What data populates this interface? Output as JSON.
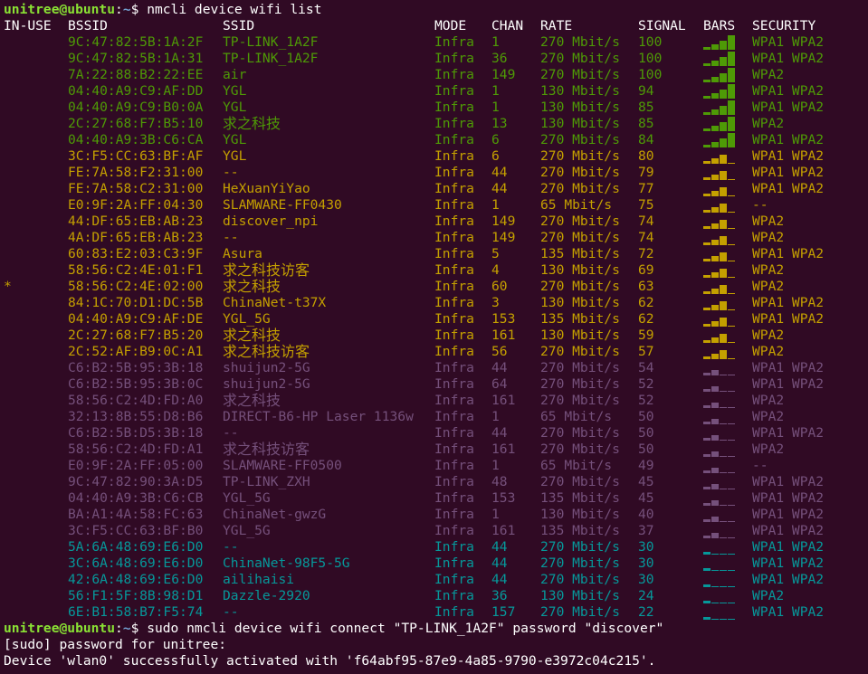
{
  "colors": {
    "background": "#300a24",
    "text": "#ffffff",
    "prompt_user": "#8ae234",
    "prompt_path": "#729fcf",
    "strong": "#4e9a06",
    "good": "#c4a000",
    "fair": "#75507b",
    "weak": "#06989a"
  },
  "prompt1": {
    "user": "unitree@ubuntu",
    "path": "~",
    "symbol": "$",
    "command": "nmcli device wifi list"
  },
  "headers": {
    "in_use": "IN-USE",
    "bssid": "BSSID",
    "ssid": "SSID",
    "mode": "MODE",
    "chan": "CHAN",
    "rate": "RATE",
    "signal": "SIGNAL",
    "bars": "BARS",
    "security": "SECURITY"
  },
  "rows": [
    {
      "in_use": "",
      "bssid": "9C:47:82:5B:1A:2F",
      "ssid": "TP-LINK_1A2F",
      "mode": "Infra",
      "chan": "1",
      "rate": "270 Mbit/s",
      "signal": "100",
      "bars": 4,
      "security": "WPA1 WPA2",
      "color": "strong"
    },
    {
      "in_use": "",
      "bssid": "9C:47:82:5B:1A:31",
      "ssid": "TP-LINK_1A2F",
      "mode": "Infra",
      "chan": "36",
      "rate": "270 Mbit/s",
      "signal": "100",
      "bars": 4,
      "security": "WPA1 WPA2",
      "color": "strong"
    },
    {
      "in_use": "",
      "bssid": "7A:22:88:B2:22:EE",
      "ssid": "air",
      "mode": "Infra",
      "chan": "149",
      "rate": "270 Mbit/s",
      "signal": "100",
      "bars": 4,
      "security": "WPA2",
      "color": "strong"
    },
    {
      "in_use": "",
      "bssid": "04:40:A9:C9:AF:DD",
      "ssid": "YGL",
      "mode": "Infra",
      "chan": "1",
      "rate": "130 Mbit/s",
      "signal": "94",
      "bars": 4,
      "security": "WPA1 WPA2",
      "color": "strong"
    },
    {
      "in_use": "",
      "bssid": "04:40:A9:C9:B0:0A",
      "ssid": "YGL",
      "mode": "Infra",
      "chan": "1",
      "rate": "130 Mbit/s",
      "signal": "85",
      "bars": 4,
      "security": "WPA1 WPA2",
      "color": "strong"
    },
    {
      "in_use": "",
      "bssid": "2C:27:68:F7:B5:10",
      "ssid": "求之科技",
      "mode": "Infra",
      "chan": "13",
      "rate": "130 Mbit/s",
      "signal": "85",
      "bars": 4,
      "security": "WPA2",
      "color": "strong"
    },
    {
      "in_use": "",
      "bssid": "04:40:A9:3B:C6:CA",
      "ssid": "YGL",
      "mode": "Infra",
      "chan": "6",
      "rate": "270 Mbit/s",
      "signal": "84",
      "bars": 4,
      "security": "WPA1 WPA2",
      "color": "strong"
    },
    {
      "in_use": "",
      "bssid": "3C:F5:CC:63:BF:AF",
      "ssid": "YGL",
      "mode": "Infra",
      "chan": "6",
      "rate": "270 Mbit/s",
      "signal": "80",
      "bars": 3,
      "security": "WPA1 WPA2",
      "color": "good"
    },
    {
      "in_use": "",
      "bssid": "FE:7A:58:F2:31:00",
      "ssid": "--",
      "mode": "Infra",
      "chan": "44",
      "rate": "270 Mbit/s",
      "signal": "79",
      "bars": 3,
      "security": "WPA1 WPA2",
      "color": "good"
    },
    {
      "in_use": "",
      "bssid": "FE:7A:58:C2:31:00",
      "ssid": "HeXuanYiYao",
      "mode": "Infra",
      "chan": "44",
      "rate": "270 Mbit/s",
      "signal": "77",
      "bars": 3,
      "security": "WPA1 WPA2",
      "color": "good"
    },
    {
      "in_use": "",
      "bssid": "E0:9F:2A:FF:04:30",
      "ssid": "SLAMWARE-FF0430",
      "mode": "Infra",
      "chan": "1",
      "rate": "65 Mbit/s",
      "signal": "75",
      "bars": 3,
      "security": "--",
      "color": "good"
    },
    {
      "in_use": "",
      "bssid": "44:DF:65:EB:AB:23",
      "ssid": "discover_npi",
      "mode": "Infra",
      "chan": "149",
      "rate": "270 Mbit/s",
      "signal": "74",
      "bars": 3,
      "security": "WPA2",
      "color": "good"
    },
    {
      "in_use": "",
      "bssid": "4A:DF:65:EB:AB:23",
      "ssid": "--",
      "mode": "Infra",
      "chan": "149",
      "rate": "270 Mbit/s",
      "signal": "74",
      "bars": 3,
      "security": "WPA2",
      "color": "good"
    },
    {
      "in_use": "",
      "bssid": "60:83:E2:03:C3:9F",
      "ssid": "Asura",
      "mode": "Infra",
      "chan": "5",
      "rate": "135 Mbit/s",
      "signal": "72",
      "bars": 3,
      "security": "WPA1 WPA2",
      "color": "good"
    },
    {
      "in_use": "",
      "bssid": "58:56:C2:4E:01:F1",
      "ssid": "求之科技访客",
      "mode": "Infra",
      "chan": "4",
      "rate": "130 Mbit/s",
      "signal": "69",
      "bars": 3,
      "security": "WPA2",
      "color": "good"
    },
    {
      "in_use": "*",
      "bssid": "58:56:C2:4E:02:00",
      "ssid": "求之科技",
      "mode": "Infra",
      "chan": "60",
      "rate": "270 Mbit/s",
      "signal": "63",
      "bars": 3,
      "security": "WPA2",
      "color": "good"
    },
    {
      "in_use": "",
      "bssid": "84:1C:70:D1:DC:5B",
      "ssid": "ChinaNet-t37X",
      "mode": "Infra",
      "chan": "3",
      "rate": "130 Mbit/s",
      "signal": "62",
      "bars": 3,
      "security": "WPA1 WPA2",
      "color": "good"
    },
    {
      "in_use": "",
      "bssid": "04:40:A9:C9:AF:DE",
      "ssid": "YGL_5G",
      "mode": "Infra",
      "chan": "153",
      "rate": "135 Mbit/s",
      "signal": "62",
      "bars": 3,
      "security": "WPA1 WPA2",
      "color": "good"
    },
    {
      "in_use": "",
      "bssid": "2C:27:68:F7:B5:20",
      "ssid": "求之科技",
      "mode": "Infra",
      "chan": "161",
      "rate": "130 Mbit/s",
      "signal": "59",
      "bars": 3,
      "security": "WPA2",
      "color": "good"
    },
    {
      "in_use": "",
      "bssid": "2C:52:AF:B9:0C:A1",
      "ssid": "求之科技访客",
      "mode": "Infra",
      "chan": "56",
      "rate": "270 Mbit/s",
      "signal": "57",
      "bars": 3,
      "security": "WPA2",
      "color": "good"
    },
    {
      "in_use": "",
      "bssid": "C6:B2:5B:95:3B:18",
      "ssid": "shuijun2-5G",
      "mode": "Infra",
      "chan": "44",
      "rate": "270 Mbit/s",
      "signal": "54",
      "bars": 2,
      "security": "WPA1 WPA2",
      "color": "fair"
    },
    {
      "in_use": "",
      "bssid": "C6:B2:5B:95:3B:0C",
      "ssid": "shuijun2-5G",
      "mode": "Infra",
      "chan": "64",
      "rate": "270 Mbit/s",
      "signal": "52",
      "bars": 2,
      "security": "WPA1 WPA2",
      "color": "fair"
    },
    {
      "in_use": "",
      "bssid": "58:56:C2:4D:FD:A0",
      "ssid": "求之科技",
      "mode": "Infra",
      "chan": "161",
      "rate": "270 Mbit/s",
      "signal": "52",
      "bars": 2,
      "security": "WPA2",
      "color": "fair"
    },
    {
      "in_use": "",
      "bssid": "32:13:8B:55:D8:B6",
      "ssid": "DIRECT-B6-HP Laser 1136w",
      "mode": "Infra",
      "chan": "1",
      "rate": "65 Mbit/s",
      "signal": "50",
      "bars": 2,
      "security": "WPA2",
      "color": "fair"
    },
    {
      "in_use": "",
      "bssid": "C6:B2:5B:D5:3B:18",
      "ssid": "--",
      "mode": "Infra",
      "chan": "44",
      "rate": "270 Mbit/s",
      "signal": "50",
      "bars": 2,
      "security": "WPA1 WPA2",
      "color": "fair"
    },
    {
      "in_use": "",
      "bssid": "58:56:C2:4D:FD:A1",
      "ssid": "求之科技访客",
      "mode": "Infra",
      "chan": "161",
      "rate": "270 Mbit/s",
      "signal": "50",
      "bars": 2,
      "security": "WPA2",
      "color": "fair"
    },
    {
      "in_use": "",
      "bssid": "E0:9F:2A:FF:05:00",
      "ssid": "SLAMWARE-FF0500",
      "mode": "Infra",
      "chan": "1",
      "rate": "65 Mbit/s",
      "signal": "49",
      "bars": 2,
      "security": "--",
      "color": "fair"
    },
    {
      "in_use": "",
      "bssid": "9C:47:82:90:3A:D5",
      "ssid": "TP-LINK_ZXH",
      "mode": "Infra",
      "chan": "48",
      "rate": "270 Mbit/s",
      "signal": "45",
      "bars": 2,
      "security": "WPA1 WPA2",
      "color": "fair"
    },
    {
      "in_use": "",
      "bssid": "04:40:A9:3B:C6:CB",
      "ssid": "YGL_5G",
      "mode": "Infra",
      "chan": "153",
      "rate": "135 Mbit/s",
      "signal": "45",
      "bars": 2,
      "security": "WPA1 WPA2",
      "color": "fair"
    },
    {
      "in_use": "",
      "bssid": "BA:A1:4A:58:FC:63",
      "ssid": "ChinaNet-gwzG",
      "mode": "Infra",
      "chan": "1",
      "rate": "130 Mbit/s",
      "signal": "40",
      "bars": 2,
      "security": "WPA1 WPA2",
      "color": "fair"
    },
    {
      "in_use": "",
      "bssid": "3C:F5:CC:63:BF:B0",
      "ssid": "YGL_5G",
      "mode": "Infra",
      "chan": "161",
      "rate": "135 Mbit/s",
      "signal": "37",
      "bars": 2,
      "security": "WPA1 WPA2",
      "color": "fair"
    },
    {
      "in_use": "",
      "bssid": "5A:6A:48:69:E6:D0",
      "ssid": "--",
      "mode": "Infra",
      "chan": "44",
      "rate": "270 Mbit/s",
      "signal": "30",
      "bars": 1,
      "security": "WPA1 WPA2",
      "color": "weak"
    },
    {
      "in_use": "",
      "bssid": "3C:6A:48:69:E6:D0",
      "ssid": "ChinaNet-98F5-5G",
      "mode": "Infra",
      "chan": "44",
      "rate": "270 Mbit/s",
      "signal": "30",
      "bars": 1,
      "security": "WPA1 WPA2",
      "color": "weak"
    },
    {
      "in_use": "",
      "bssid": "42:6A:48:69:E6:D0",
      "ssid": "ailihaisi",
      "mode": "Infra",
      "chan": "44",
      "rate": "270 Mbit/s",
      "signal": "30",
      "bars": 1,
      "security": "WPA1 WPA2",
      "color": "weak"
    },
    {
      "in_use": "",
      "bssid": "56:F1:5F:8B:98:D1",
      "ssid": "Dazzle-2920",
      "mode": "Infra",
      "chan": "36",
      "rate": "130 Mbit/s",
      "signal": "24",
      "bars": 1,
      "security": "WPA2",
      "color": "weak"
    },
    {
      "in_use": "",
      "bssid": "6E:B1:58:B7:F5:74",
      "ssid": "--",
      "mode": "Infra",
      "chan": "157",
      "rate": "270 Mbit/s",
      "signal": "22",
      "bars": 1,
      "security": "WPA1 WPA2",
      "color": "weak"
    }
  ],
  "prompt2": {
    "user": "unitree@ubuntu",
    "path": "~",
    "symbol": "$",
    "command": "sudo nmcli device wifi connect \"TP-LINK_1A2F\" password \"discover\""
  },
  "output1": "[sudo] password for unitree:",
  "output2": "Device 'wlan0' successfully activated with 'f64abf95-87e9-4a85-9790-e3972c04c215'."
}
